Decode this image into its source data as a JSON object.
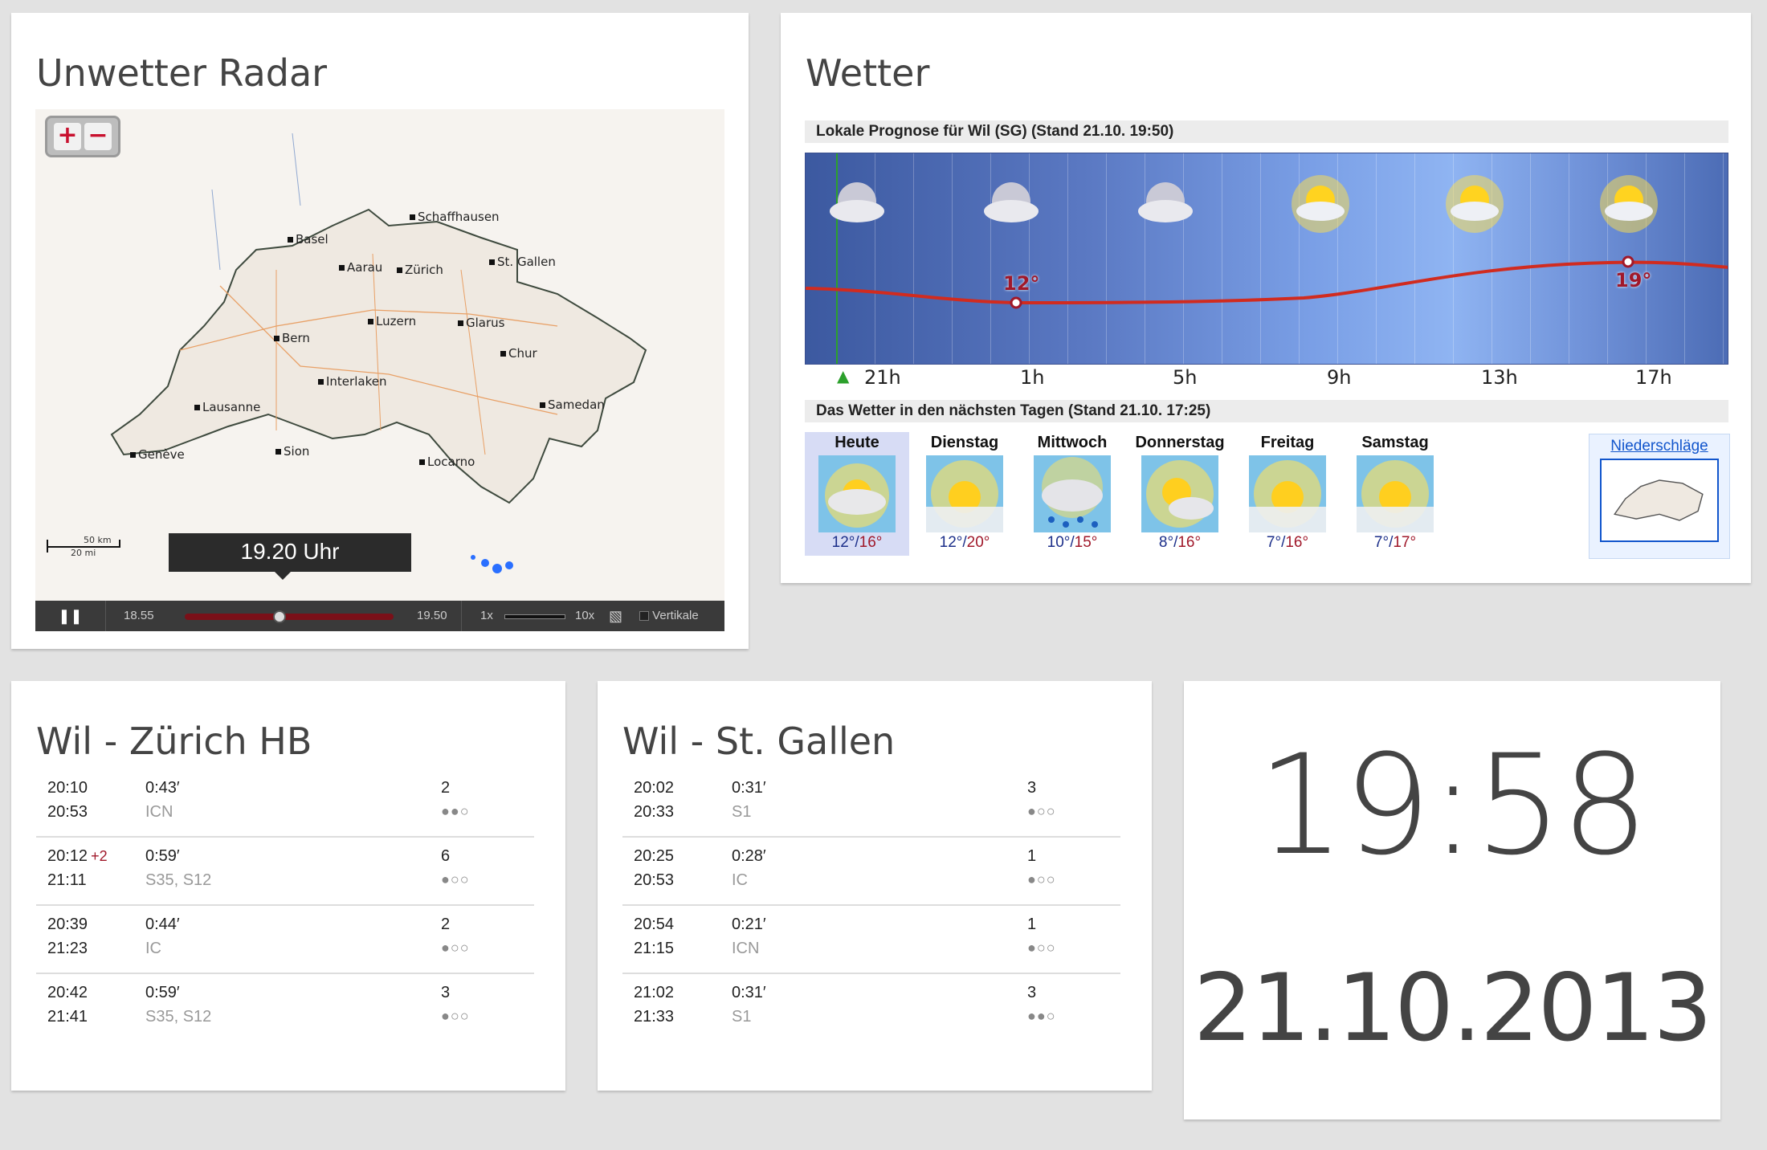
{
  "radar": {
    "title": "Unwetter Radar",
    "zoom_in": "+",
    "zoom_out": "−",
    "cities": [
      "Schaffhausen",
      "Basel",
      "Aarau",
      "Zürich",
      "St. Gallen",
      "Luzern",
      "Glarus",
      "Bern",
      "Chur",
      "Interlaken",
      "Lausanne",
      "Samedan",
      "Genève",
      "Sion",
      "Locarno"
    ],
    "scale_km": "50 km",
    "scale_mi": "20 mi",
    "current_time": "19.20 Uhr",
    "start_time": "18.55",
    "end_time": "19.50",
    "speed_min": "1x",
    "speed_max": "10x",
    "vertical_label": "Vertikale",
    "pause_icon": "pause-icon"
  },
  "weather": {
    "title": "Wetter",
    "forecast_header": "Lokale Prognose für Wil (SG) (Stand 21.10. 19:50)",
    "hours": [
      "21h",
      "1h",
      "5h",
      "9h",
      "13h",
      "17h"
    ],
    "temp_min_label": "12°",
    "temp_max_label": "19°",
    "days_header": "Das Wetter in den nächsten Tagen (Stand 21.10. 17:25)",
    "days": [
      {
        "name": "Heute",
        "lo": "12°",
        "hi": "16°",
        "icon": "cloud-sun-icon"
      },
      {
        "name": "Dienstag",
        "lo": "12°",
        "hi": "20°",
        "icon": "sun-icon"
      },
      {
        "name": "Mittwoch",
        "lo": "10°",
        "hi": "15°",
        "icon": "rain-icon"
      },
      {
        "name": "Donnerstag",
        "lo": "8°",
        "hi": "16°",
        "icon": "cloud-sun-icon"
      },
      {
        "name": "Freitag",
        "lo": "7°",
        "hi": "16°",
        "icon": "sun-icon"
      },
      {
        "name": "Samstag",
        "lo": "7°",
        "hi": "17°",
        "icon": "sun-icon"
      }
    ],
    "precip_link": "Niederschläge"
  },
  "train1": {
    "title": "Wil - Zürich HB",
    "rows": [
      {
        "dep": "20:10",
        "delay": "",
        "arr": "20:53",
        "dur": "0:43′",
        "line": "ICN",
        "chg": "2",
        "occ": "●●○"
      },
      {
        "dep": "20:12",
        "delay": "+2",
        "arr": "21:11",
        "dur": "0:59′",
        "line": "S35, S12",
        "chg": "6",
        "occ": "●○○"
      },
      {
        "dep": "20:39",
        "delay": "",
        "arr": "21:23",
        "dur": "0:44′",
        "line": "IC",
        "chg": "2",
        "occ": "●○○"
      },
      {
        "dep": "20:42",
        "delay": "",
        "arr": "21:41",
        "dur": "0:59′",
        "line": "S35, S12",
        "chg": "3",
        "occ": "●○○"
      }
    ]
  },
  "train2": {
    "title": "Wil - St. Gallen",
    "rows": [
      {
        "dep": "20:02",
        "delay": "",
        "arr": "20:33",
        "dur": "0:31′",
        "line": "S1",
        "chg": "3",
        "occ": "●○○"
      },
      {
        "dep": "20:25",
        "delay": "",
        "arr": "20:53",
        "dur": "0:28′",
        "line": "IC",
        "chg": "1",
        "occ": "●○○"
      },
      {
        "dep": "20:54",
        "delay": "",
        "arr": "21:15",
        "dur": "0:21′",
        "line": "ICN",
        "chg": "1",
        "occ": "●○○"
      },
      {
        "dep": "21:02",
        "delay": "",
        "arr": "21:33",
        "dur": "0:31′",
        "line": "S1",
        "chg": "3",
        "occ": "●●○"
      }
    ]
  },
  "clock": {
    "time": "19:58",
    "date": "21.10.2013"
  }
}
